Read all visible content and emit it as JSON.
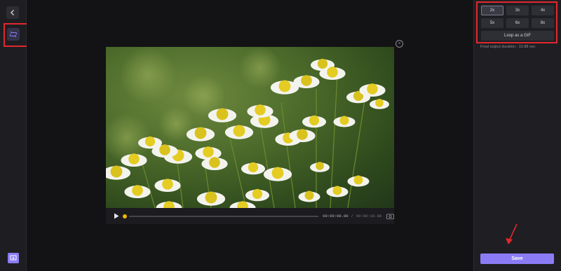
{
  "left_rail": {
    "back_icon": "chevron-left-icon",
    "loop_icon": "loop-icon",
    "export_icon": "export-icon"
  },
  "player": {
    "current_time": "00:00:00.00",
    "separator": "/",
    "total_time": "00:00:10.88",
    "progress": 0,
    "play_icon": "play-icon",
    "snapshot_icon": "snapshot-icon",
    "close_icon": "close-circle-icon"
  },
  "speeds": [
    {
      "label": "2x",
      "active": true
    },
    {
      "label": "3x",
      "active": false
    },
    {
      "label": "4x",
      "active": false
    },
    {
      "label": "5x",
      "active": false
    },
    {
      "label": "6x",
      "active": false
    },
    {
      "label": "8x",
      "active": false
    }
  ],
  "loop_gif_label": "Loop as a GIF",
  "duration_text": "Final output duration : 10.88 sec",
  "save_label": "Save",
  "colors": {
    "accent": "#8b7cf6",
    "highlight_box": "#e0282e",
    "progress_knob": "#f2b705"
  }
}
